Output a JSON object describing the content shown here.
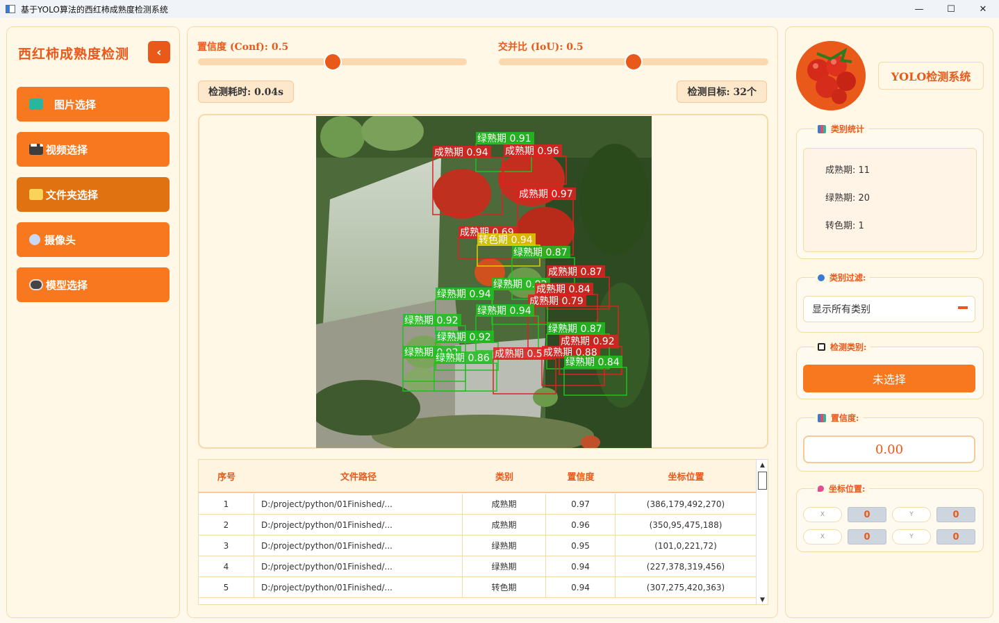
{
  "window": {
    "title": "基于YOLO算法的西红柿成熟度检测系统",
    "minimize": "—",
    "maximize": "☐",
    "close": "✕"
  },
  "sidebar": {
    "brand": "西红柿成熟度检测",
    "collapse_icon": "‹",
    "items": [
      {
        "label": "图片选择",
        "icon": "image-icon"
      },
      {
        "label": "视频选择",
        "icon": "video-icon"
      },
      {
        "label": "文件夹选择",
        "icon": "folder-icon"
      },
      {
        "label": "摄像头",
        "icon": "camera-icon"
      },
      {
        "label": "模型选择",
        "icon": "model-icon"
      }
    ]
  },
  "controls": {
    "conf_label": "置信度 (Conf): 0.5",
    "conf_value": 0.5,
    "iou_label": "交并比 (IoU): 0.5",
    "iou_value": 0.5,
    "time_label": "检测耗时: 0.04s",
    "count_label": "检测目标: 32个"
  },
  "detections_overlay": [
    {
      "label": "绿熟期 0.91"
    },
    {
      "label": "成熟期 0.96"
    },
    {
      "label": "成熟期 0.94"
    },
    {
      "label": "成熟期 0.97"
    },
    {
      "label": "成熟期 0.69"
    },
    {
      "label": "转色期 0.94"
    },
    {
      "label": "绿熟期 0.87"
    },
    {
      "label": "成熟期 0.87"
    },
    {
      "label": "绿熟期 0.92"
    },
    {
      "label": "成熟期 0.84"
    },
    {
      "label": "绿熟期 0.94"
    },
    {
      "label": "成熟期 0.79"
    },
    {
      "label": "绿熟期 0.94"
    },
    {
      "label": "绿熟期 0.92"
    },
    {
      "label": "绿熟期 0.87"
    },
    {
      "label": "绿熟期 0.92"
    },
    {
      "label": "成熟期 0.92"
    },
    {
      "label": "绿熟期 0.92"
    },
    {
      "label": "成熟期 0.55"
    },
    {
      "label": "成熟期 0.88"
    },
    {
      "label": "绿熟期 0.86"
    },
    {
      "label": "绿熟期 0.84"
    }
  ],
  "table": {
    "headers": [
      "序号",
      "文件路径",
      "类别",
      "置信度",
      "坐标位置"
    ],
    "rows": [
      {
        "id": "1",
        "path": "D:/project/python/01Finished/...",
        "cls": "成熟期",
        "conf": "0.97",
        "box": "(386,179,492,270)"
      },
      {
        "id": "2",
        "path": "D:/project/python/01Finished/...",
        "cls": "成熟期",
        "conf": "0.96",
        "box": "(350,95,475,188)"
      },
      {
        "id": "3",
        "path": "D:/project/python/01Finished/...",
        "cls": "绿熟期",
        "conf": "0.95",
        "box": "(101,0,221,72)"
      },
      {
        "id": "4",
        "path": "D:/project/python/01Finished/...",
        "cls": "绿熟期",
        "conf": "0.94",
        "box": "(227,378,319,456)"
      },
      {
        "id": "5",
        "path": "D:/project/python/01Finished/...",
        "cls": "转色期",
        "conf": "0.94",
        "box": "(307,275,420,363)"
      }
    ],
    "scroll_up": "▲",
    "scroll_down": "▼"
  },
  "right": {
    "system_title": "YOLO检测系统",
    "stats_title": "类别统计",
    "stats": [
      "成熟期: 11",
      "绿熟期: 20",
      "转色期: 1"
    ],
    "filter_title": "类别过滤:",
    "filter_value": "显示所有类别",
    "detect_class_title": "检测类别:",
    "detect_class_value": "未选择",
    "conf_title": "置信度:",
    "conf_value": "0.00",
    "coord_title": "坐标位置:",
    "coords": [
      {
        "label": "X",
        "value": "0"
      },
      {
        "label": "Y",
        "value": "0"
      },
      {
        "label": "X",
        "value": "0"
      },
      {
        "label": "Y",
        "value": "0"
      }
    ]
  },
  "colors": {
    "accent": "#e8591a",
    "button": "#f7781f",
    "panel_bg": "#fff8e6",
    "ripe_box": "#e02020",
    "green_box": "#20c020",
    "turning_box": "#e0d000"
  }
}
